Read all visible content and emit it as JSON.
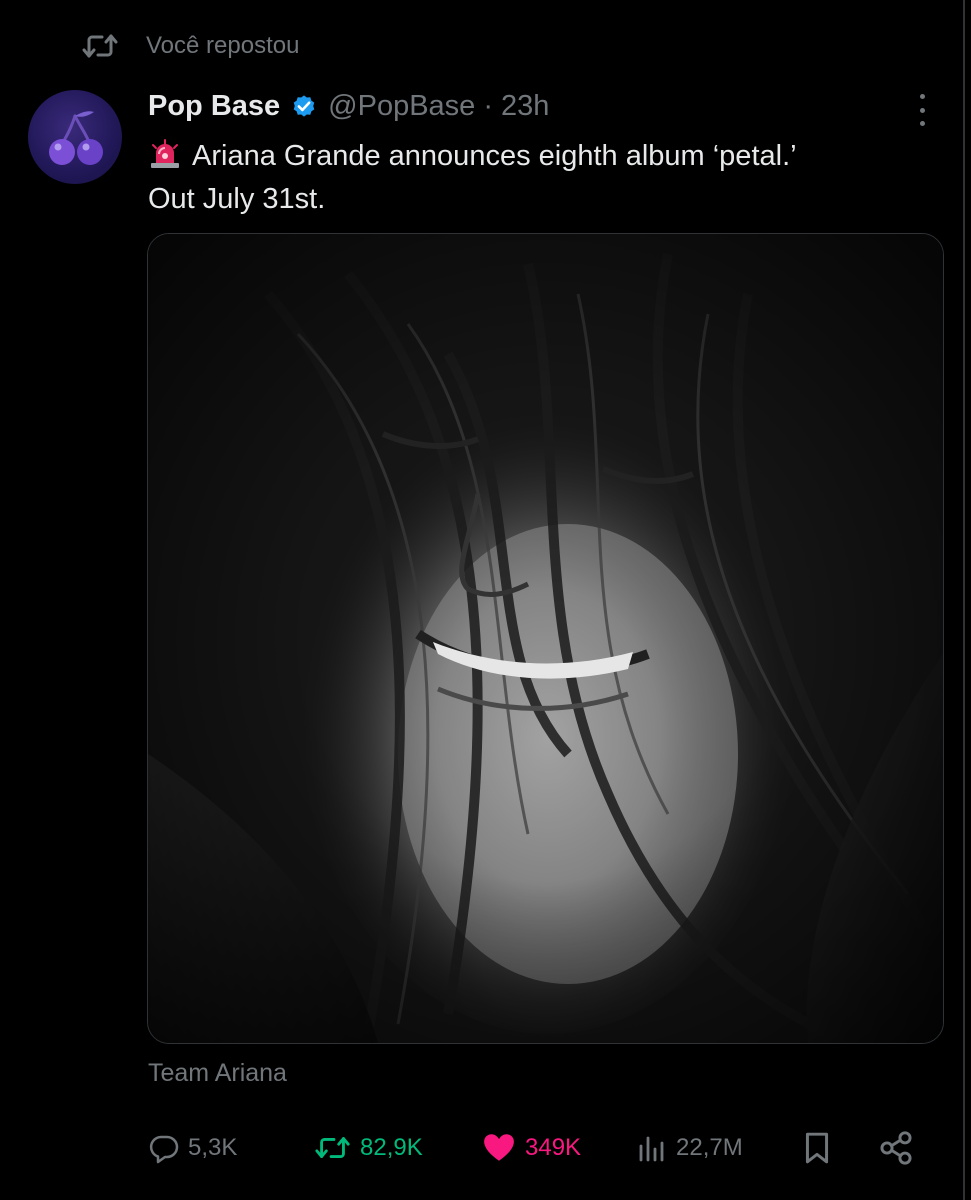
{
  "repost_header": {
    "text": "Você repostou"
  },
  "post": {
    "author_name": "Pop Base",
    "verified": true,
    "handle": "@PopBase",
    "separator": "·",
    "time": "23h",
    "emoji": "🚨",
    "text_line1": "Ariana Grande announces eighth album ‘petal.’",
    "text_line2": "Out July 31st.",
    "media_caption": "Team Ariana"
  },
  "actions": {
    "replies": "5,3K",
    "reposts": "82,9K",
    "likes": "349K",
    "views": "22,7M"
  },
  "colors": {
    "background": "#000000",
    "text_primary": "#e7e9ea",
    "text_secondary": "#71767b",
    "verified_blue": "#1d9bf0",
    "repost_green": "#00ba7c",
    "like_pink": "#f91880"
  },
  "icons": {
    "repost_header": "repost-icon",
    "avatar": "cherry-icon",
    "verified": "verified-badge-icon",
    "more": "more-dots-icon",
    "reply": "reply-icon",
    "repost": "repost-icon",
    "like": "heart-icon",
    "views": "views-bar-icon",
    "bookmark": "bookmark-icon",
    "share": "share-icon"
  },
  "state": {
    "reposted_by_user": true,
    "liked_by_user": true
  }
}
